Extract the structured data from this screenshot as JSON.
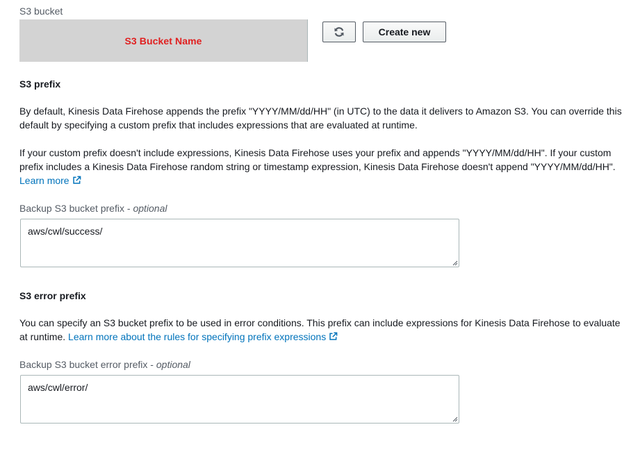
{
  "s3_bucket": {
    "label": "S3 bucket",
    "selected_value": "S3 Bucket Name",
    "refresh_icon": "refresh-icon",
    "create_new_label": "Create new",
    "highlight_color": "#e02020"
  },
  "s3_prefix": {
    "title": "S3 prefix",
    "description_1": "By default, Kinesis Data Firehose appends the prefix \"YYYY/MM/dd/HH\" (in UTC) to the data it delivers to Amazon S3. You can override this default by specifying a custom prefix that includes expressions that are evaluated at runtime.",
    "description_2": "If your custom prefix doesn't include expressions, Kinesis Data Firehose uses your prefix and appends \"YYYY/MM/dd/HH\". If your custom prefix includes a Kinesis Data Firehose random string or timestamp expression, Kinesis Data Firehose doesn't append \"YYYY/MM/dd/HH\".",
    "learn_more_label": "Learn more",
    "field_label": "Backup S3 bucket prefix",
    "field_optional": "optional",
    "field_value": "aws/cwl/success/"
  },
  "s3_error_prefix": {
    "title": "S3 error prefix",
    "description": "You can specify an S3 bucket prefix to be used in error conditions. This prefix can include expressions for Kinesis Data Firehose to evaluate at runtime.",
    "learn_more_label": "Learn more about the rules for specifying prefix expressions",
    "field_label": "Backup S3 bucket error prefix",
    "field_optional": "optional",
    "field_value": "aws/cwl/error/"
  },
  "colors": {
    "link": "#0073bb",
    "text": "#16191f",
    "muted": "#545b64",
    "border": "#aab7b8"
  }
}
